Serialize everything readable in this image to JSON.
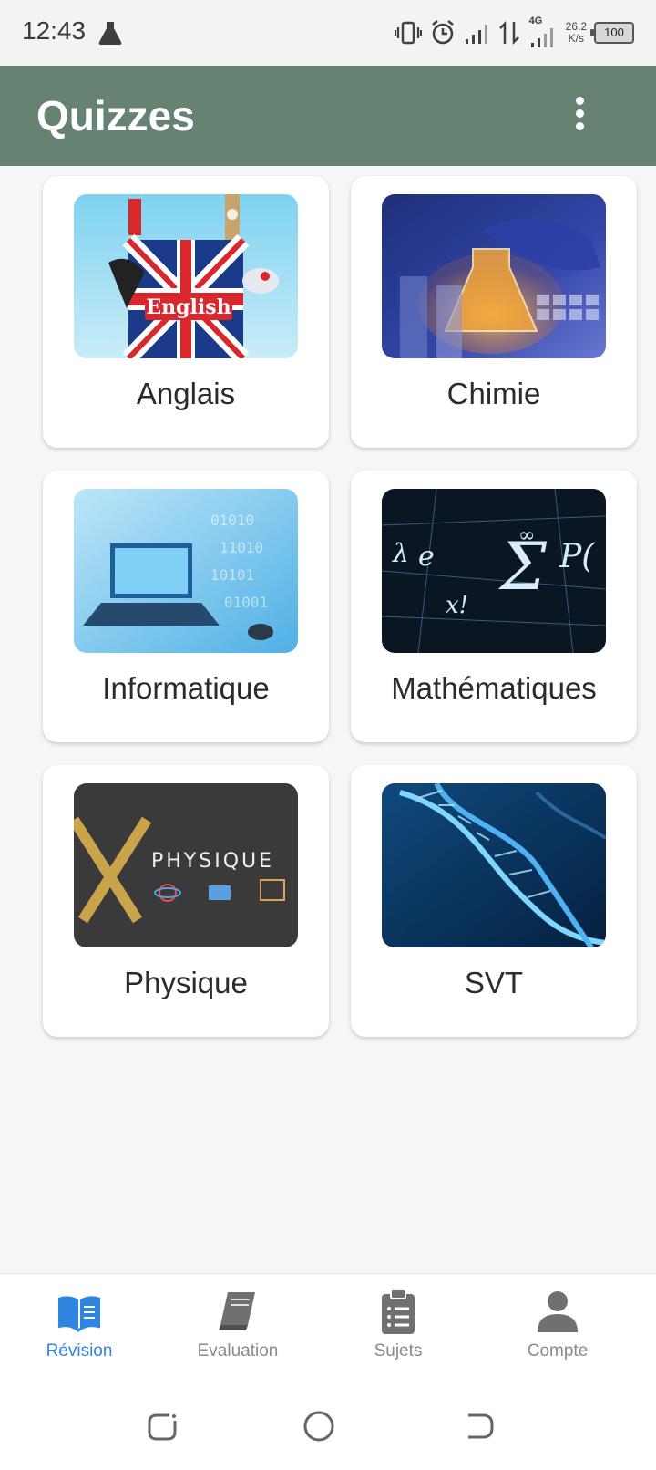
{
  "status_bar": {
    "time": "12:43",
    "network_speed_value": "26,2",
    "network_speed_unit": "K/s",
    "signal_type": "4G",
    "battery_level": "100",
    "icons": [
      "flask-icon",
      "vibrate-icon",
      "alarm-icon",
      "signal-icon",
      "data-transfer-icon",
      "signal-4g-icon",
      "battery-icon"
    ]
  },
  "app_bar": {
    "title": "Quizzes",
    "menu_icon": "more-vert-icon",
    "color": "#658273"
  },
  "subjects": [
    {
      "label": "Anglais",
      "image_text": "English"
    },
    {
      "label": "Chimie"
    },
    {
      "label": "Informatique"
    },
    {
      "label": "Mathématiques"
    },
    {
      "label": "Physique",
      "image_text": "PHYSIQUE"
    },
    {
      "label": "SVT"
    }
  ],
  "bottom_nav": {
    "active_color": "#2f86e0",
    "inactive_color": "#8a8a8a",
    "items": [
      {
        "label": "Révision",
        "icon": "open-book-icon",
        "active": true
      },
      {
        "label": "Evaluation",
        "icon": "book-icon",
        "active": false
      },
      {
        "label": "Sujets",
        "icon": "clipboard-list-icon",
        "active": false
      },
      {
        "label": "Compte",
        "icon": "person-icon",
        "active": false
      }
    ]
  }
}
